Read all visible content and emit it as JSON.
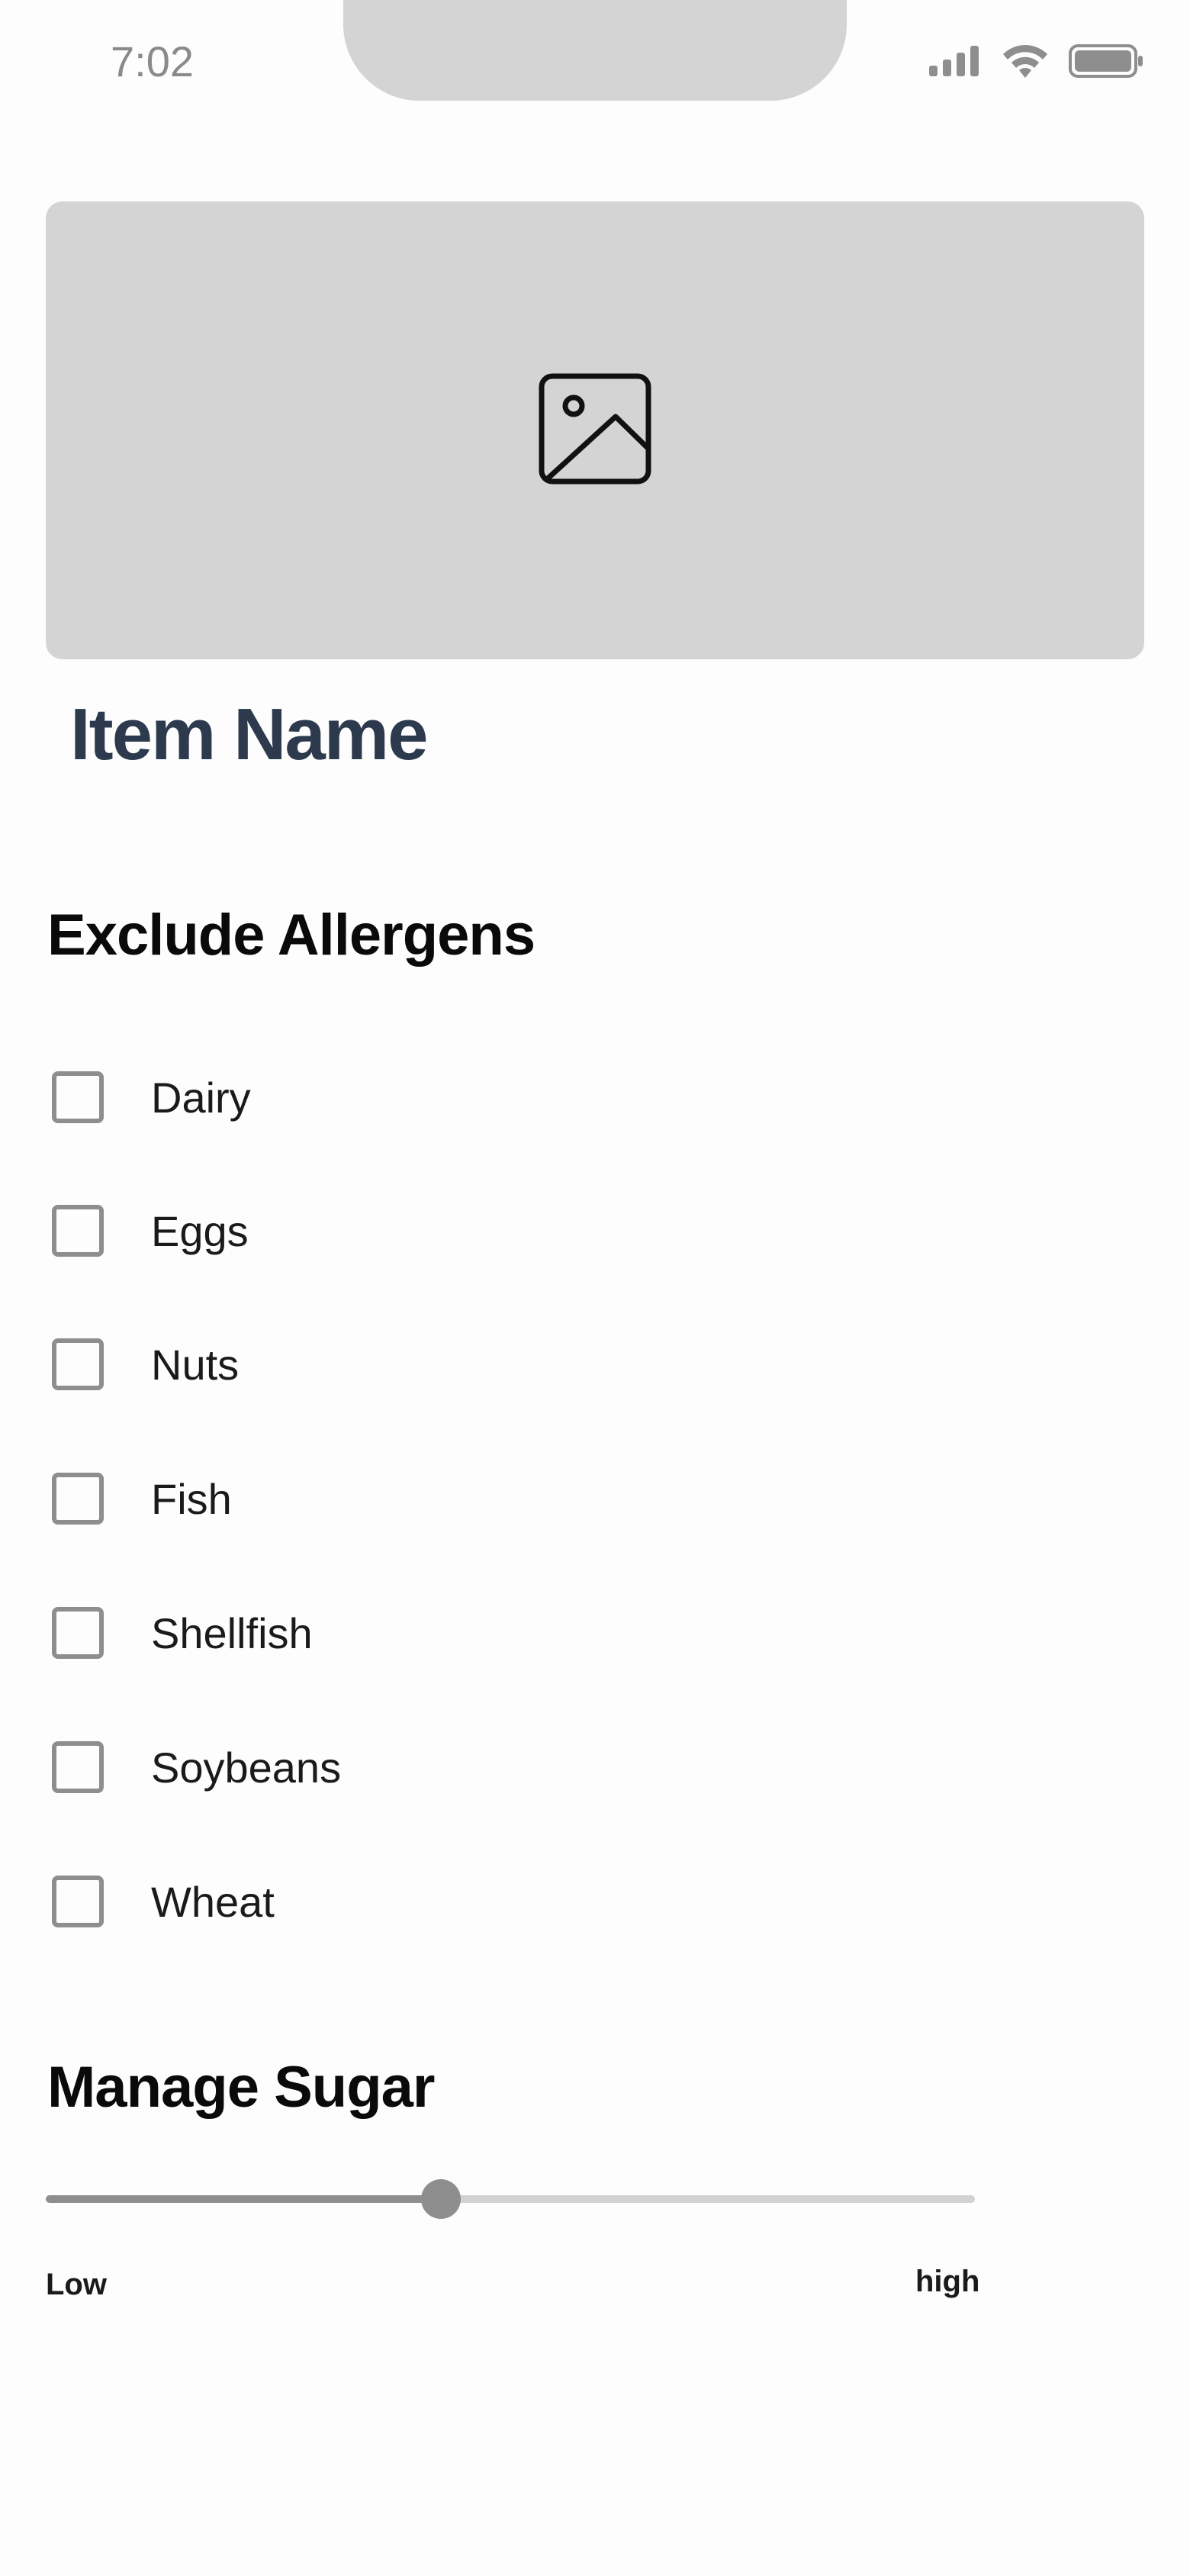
{
  "status_bar": {
    "time": "7:02",
    "icons": [
      "cellular-signal-icon",
      "wifi-icon",
      "battery-icon"
    ]
  },
  "hero": {
    "icon": "image-placeholder-icon"
  },
  "item": {
    "name": "Item Name"
  },
  "allergens": {
    "title": "Exclude Allergens",
    "items": [
      {
        "label": "Dairy",
        "checked": false
      },
      {
        "label": "Eggs",
        "checked": false
      },
      {
        "label": "Nuts",
        "checked": false
      },
      {
        "label": "Fish",
        "checked": false
      },
      {
        "label": "Shellfish",
        "checked": false
      },
      {
        "label": "Soybeans",
        "checked": false
      },
      {
        "label": "Wheat",
        "checked": false
      }
    ]
  },
  "sugar": {
    "title": "Manage Sugar",
    "level": 0.425,
    "low_label": "Low",
    "high_label": "high"
  },
  "colors": {
    "heading": "#0a0a0a",
    "item_name": "#2d3a4e",
    "placeholder": "#d4d4d4",
    "control": "#8e8e8e",
    "track": "#d2d2d2"
  }
}
